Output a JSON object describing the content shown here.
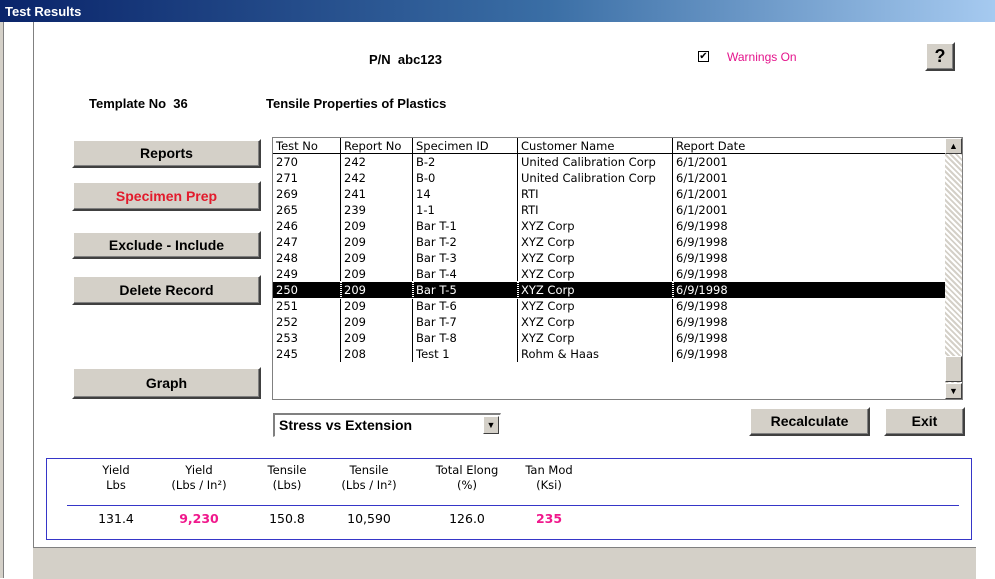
{
  "window": {
    "title": "Test Results"
  },
  "header": {
    "pn_label": "P/N",
    "pn_value": "abc123",
    "warnings_label": "Warnings On",
    "warnings_checked": true,
    "help_icon": "question-mark-icon",
    "template_label": "Template No",
    "template_no": "36",
    "template_name": "Tensile Properties of Plastics"
  },
  "buttons": {
    "reports": "Reports",
    "specimen_prep": "Specimen Prep",
    "exclude_include": "Exclude - Include",
    "delete_record": "Delete Record",
    "graph": "Graph",
    "recalculate": "Recalculate",
    "exit": "Exit"
  },
  "grid": {
    "columns": [
      "Test No",
      "Report No",
      "Specimen ID",
      "Customer Name",
      "Report Date"
    ],
    "selected_row": 8,
    "rows": [
      [
        "270",
        "242",
        "B-2",
        "United Calibration Corp",
        "6/1/2001"
      ],
      [
        "271",
        "242",
        "B-0",
        "United Calibration Corp",
        "6/1/2001"
      ],
      [
        "269",
        "241",
        "14",
        "RTI",
        "6/1/2001"
      ],
      [
        "265",
        "239",
        "1-1",
        "RTI",
        "6/1/2001"
      ],
      [
        "246",
        "209",
        "Bar T-1",
        "XYZ Corp",
        "6/9/1998"
      ],
      [
        "247",
        "209",
        "Bar T-2",
        "XYZ Corp",
        "6/9/1998"
      ],
      [
        "248",
        "209",
        "Bar T-3",
        "XYZ Corp",
        "6/9/1998"
      ],
      [
        "249",
        "209",
        "Bar T-4",
        "XYZ Corp",
        "6/9/1998"
      ],
      [
        "250",
        "209",
        "Bar T-5",
        "XYZ Corp",
        "6/9/1998"
      ],
      [
        "251",
        "209",
        "Bar T-6",
        "XYZ Corp",
        "6/9/1998"
      ],
      [
        "252",
        "209",
        "Bar T-7",
        "XYZ Corp",
        "6/9/1998"
      ],
      [
        "253",
        "209",
        "Bar T-8",
        "XYZ Corp",
        "6/9/1998"
      ],
      [
        "245",
        "208",
        "Test 1",
        "Rohm & Haas",
        "6/9/1998"
      ]
    ]
  },
  "graph_select": {
    "value": "Stress vs Extension"
  },
  "results": {
    "headers": [
      [
        "Yield",
        "Lbs"
      ],
      [
        "Yield",
        "(Lbs / In²)"
      ],
      [
        "Tensile",
        "(Lbs)"
      ],
      [
        "Tensile",
        "(Lbs / In²)"
      ],
      [
        "Total Elong",
        "(%)"
      ],
      [
        "Tan Mod",
        "(Ksi)"
      ]
    ],
    "values": [
      "131.4",
      "9,230",
      "150.8",
      "10,590",
      "126.0",
      "235"
    ],
    "highlight_color": "#f0188c"
  },
  "colors": {
    "title_bar": "#0a246a",
    "accent_red": "#e21b2c",
    "frame_blue": "#3636c8"
  }
}
